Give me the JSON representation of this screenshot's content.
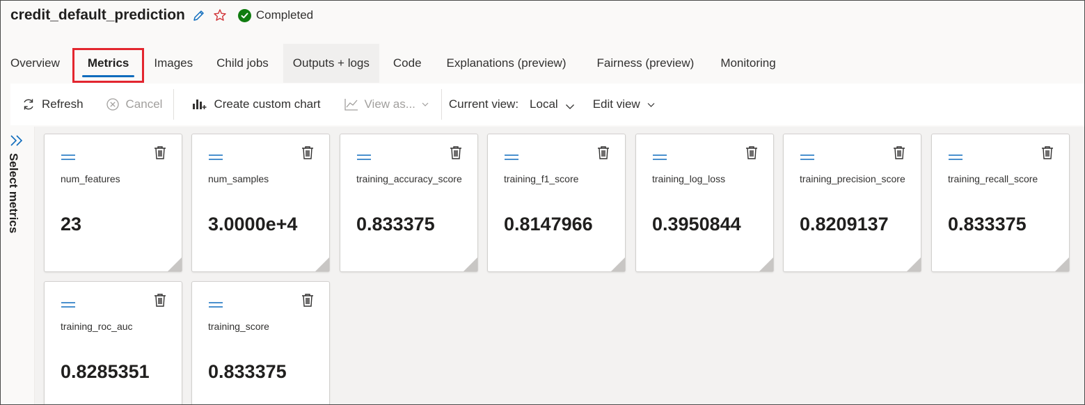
{
  "job": {
    "title": "credit_default_prediction",
    "status": "Completed",
    "status_color": "#107c10"
  },
  "tabs": [
    {
      "label": "Overview"
    },
    {
      "label": "Metrics",
      "active": true
    },
    {
      "label": "Images"
    },
    {
      "label": "Child jobs"
    },
    {
      "label": "Outputs + logs"
    },
    {
      "label": "Code"
    },
    {
      "label": "Explanations (preview)"
    },
    {
      "label": "Fairness (preview)"
    },
    {
      "label": "Monitoring"
    }
  ],
  "toolbar": {
    "refresh": "Refresh",
    "cancel": "Cancel",
    "create_chart": "Create custom chart",
    "view_as": "View as...",
    "current_view_label": "Current view:",
    "current_view_value": "Local",
    "edit_view": "Edit view"
  },
  "rail": {
    "label": "Select metrics"
  },
  "metrics": [
    {
      "name": "num_features",
      "value": "23"
    },
    {
      "name": "num_samples",
      "value": "3.0000e+4"
    },
    {
      "name": "training_accuracy_score",
      "value": "0.833375"
    },
    {
      "name": "training_f1_score",
      "value": "0.8147966"
    },
    {
      "name": "training_log_loss",
      "value": "0.3950844"
    },
    {
      "name": "training_precision_score",
      "value": "0.8209137"
    },
    {
      "name": "training_recall_score",
      "value": "0.833375"
    },
    {
      "name": "training_roc_auc",
      "value": "0.8285351"
    },
    {
      "name": "training_score",
      "value": "0.833375"
    }
  ],
  "colors": {
    "accent": "#0f6cbd",
    "highlight_box": "#e3262f",
    "favorite_star": "#d13438"
  }
}
